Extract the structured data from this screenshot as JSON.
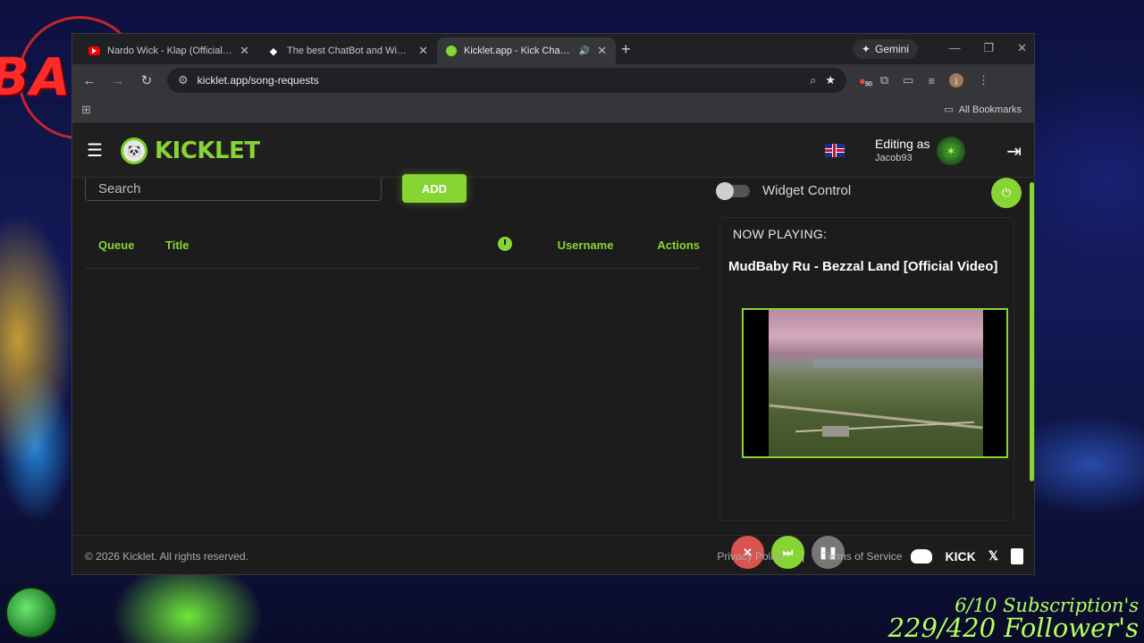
{
  "stream": {
    "logo_text": "BANG",
    "subscriptions": "6/10 Subscription's",
    "followers": "229/420 Follower's"
  },
  "browser": {
    "tabs": [
      {
        "title": "Nardo Wick - Klap (Official Vide",
        "favicon": "youtube-icon"
      },
      {
        "title": "The best ChatBot and Widgets",
        "favicon": "diamond-icon"
      },
      {
        "title": "Kicklet.app - Kick Chatbot a",
        "favicon": "kicklet-icon",
        "active": true,
        "audio": true
      }
    ],
    "gemini_label": "Gemini",
    "url": "kicklet.app/song-requests",
    "extension_badge": "90",
    "profile_initial": "j",
    "bookmarks_label": "All Bookmarks"
  },
  "app": {
    "brand": "KICKLET",
    "editing_label": "Editing as",
    "username": "Jacob93",
    "search_placeholder": "Search",
    "add_label": "ADD",
    "columns": {
      "queue": "Queue",
      "title": "Title",
      "username": "Username",
      "actions": "Actions"
    },
    "widget_control_label": "Widget Control",
    "now_playing_label": "NOW PLAYING:",
    "now_playing_title": "MudBaby Ru - Bezzal Land [Official Video]",
    "footer": {
      "copyright": "© 2026 Kicklet. All rights reserved.",
      "privacy": "Privacy Policy",
      "separator": "|",
      "terms": "Terms of Service",
      "kick_label": "KICK"
    }
  },
  "colors": {
    "accent": "#86d532",
    "stop": "#d9534f",
    "pause": "#777777"
  }
}
